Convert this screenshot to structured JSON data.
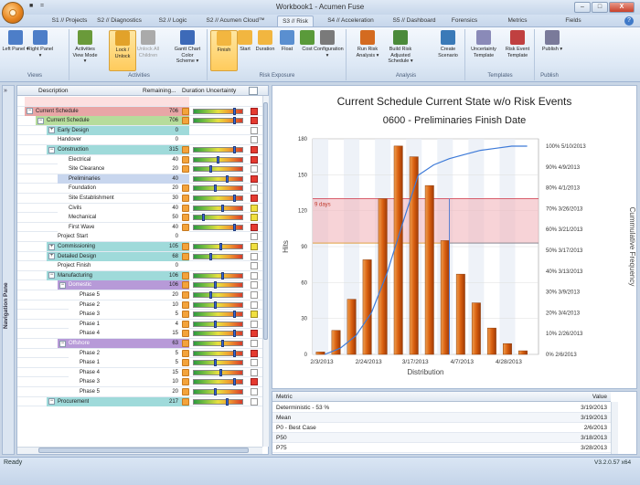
{
  "window": {
    "title": "Workbook1 - Acumen Fuse",
    "qat_save": "■",
    "qat_more": "=",
    "minimize": "–",
    "maximize": "□",
    "close": "X"
  },
  "tabs": [
    {
      "label": "S1 // Projects"
    },
    {
      "label": "S2 // Diagnostics"
    },
    {
      "label": "S2 // Logic"
    },
    {
      "label": "S2 // Acumen Cloud™"
    },
    {
      "label": "S3 // Risk"
    },
    {
      "label": "S4 // Acceleration"
    },
    {
      "label": "S5 // Dashboard"
    },
    {
      "label": "Forensics"
    },
    {
      "label": "Metrics"
    },
    {
      "label": "Fields"
    }
  ],
  "help_icon": "?",
  "ribbon": {
    "buttons": [
      {
        "label": "Left Panel ▾"
      },
      {
        "label": "Right Panel ▾"
      },
      {
        "label": "Activities View Mode ▾"
      },
      {
        "label": "Lock / Unlock"
      },
      {
        "label": "Unlock All Children"
      },
      {
        "label": "Gantt Chart Color Scheme ▾"
      },
      {
        "label": "Finish"
      },
      {
        "label": "Start"
      },
      {
        "label": "Duration"
      },
      {
        "label": "Float"
      },
      {
        "label": "Cost"
      },
      {
        "label": "Configuration ▾"
      },
      {
        "label": "Run Risk Analysis ▾"
      },
      {
        "label": "Build Risk Adjusted Schedule ▾"
      },
      {
        "label": "Create Scenario"
      },
      {
        "label": "Uncertainty Template"
      },
      {
        "label": "Risk Event Template"
      },
      {
        "label": "Publish ▾"
      }
    ],
    "groups": [
      {
        "label": "Views"
      },
      {
        "label": "Activities"
      },
      {
        "label": "Risk Exposure"
      },
      {
        "label": "Analysis"
      },
      {
        "label": "Templates"
      },
      {
        "label": "Publish"
      }
    ]
  },
  "nav_pane": {
    "label": "Navigation Pane",
    "collapse": "»"
  },
  "grid": {
    "headers": {
      "description": "Description",
      "remaining": "Remaining...",
      "uncertainty": "Duration Uncertainty"
    },
    "rows": [
      {
        "name": "",
        "val": "",
        "indent": 0,
        "tog": "",
        "bg": "#fce0e0"
      },
      {
        "name": "Current Schedule",
        "val": "706",
        "indent": 0,
        "tog": "−",
        "bg": "#e8a6a6",
        "ux": true,
        "bar": true,
        "thumb": 0.84,
        "gi": "r"
      },
      {
        "name": "Current Schedule",
        "val": "706",
        "indent": 1,
        "tog": "−",
        "bg": "#b6dc9b",
        "ux": true,
        "bar": true,
        "thumb": 0.84,
        "gi": "r"
      },
      {
        "name": "Early Design",
        "val": "0",
        "indent": 2,
        "tog": "+",
        "bg": "#9fdada",
        "gi": "w"
      },
      {
        "name": "Handover",
        "val": "0",
        "indent": 2,
        "tog": "",
        "bg": "#ffffff",
        "gi": "w"
      },
      {
        "name": "Construction",
        "val": "315",
        "indent": 2,
        "tog": "−",
        "bg": "#9fdada",
        "ux": true,
        "bar": true,
        "thumb": 0.84,
        "gi": "r"
      },
      {
        "name": "Electrical",
        "val": "40",
        "indent": 3,
        "tog": "",
        "bg": "#ffffff",
        "ux": true,
        "bar": true,
        "thumb": 0.5,
        "gi": "r"
      },
      {
        "name": "Site Clearance",
        "val": "20",
        "indent": 3,
        "tog": "",
        "bg": "#ffffff",
        "ux": true,
        "bar": true,
        "thumb": 0.35,
        "gi": "w"
      },
      {
        "name": "Preliminaries",
        "val": "40",
        "indent": 3,
        "tog": "",
        "bg": "#c8d6ee",
        "ux": false,
        "bar": true,
        "thumb": 0.7,
        "gi": "r"
      },
      {
        "name": "Foundation",
        "val": "20",
        "indent": 3,
        "tog": "",
        "bg": "#ffffff",
        "ux": true,
        "bar": true,
        "thumb": 0.45,
        "gi": "w"
      },
      {
        "name": "Site Establishment",
        "val": "30",
        "indent": 3,
        "tog": "",
        "bg": "#ffffff",
        "ux": true,
        "bar": true,
        "thumb": 0.84,
        "gi": "r"
      },
      {
        "name": "Civils",
        "val": "40",
        "indent": 3,
        "tog": "",
        "bg": "#ffffff",
        "ux": true,
        "bar": true,
        "thumb": 0.6,
        "gi": "y"
      },
      {
        "name": "Mechanical",
        "val": "50",
        "indent": 3,
        "tog": "",
        "bg": "#ffffff",
        "ux": true,
        "bar": true,
        "thumb": 0.2,
        "gi": "y"
      },
      {
        "name": "First Wave",
        "val": "40",
        "indent": 3,
        "tog": "",
        "bg": "#ffffff",
        "ux": true,
        "bar": true,
        "thumb": 0.84,
        "gi": "r"
      },
      {
        "name": "Project Start",
        "val": "0",
        "indent": 2,
        "tog": "",
        "bg": "#ffffff",
        "gi": "w"
      },
      {
        "name": "Commissioning",
        "val": "105",
        "indent": 2,
        "tog": "+",
        "bg": "#9fdada",
        "ux": true,
        "bar": true,
        "thumb": 0.55,
        "gi": "y"
      },
      {
        "name": "Detailed Design",
        "val": "68",
        "indent": 2,
        "tog": "+",
        "bg": "#9fdada",
        "ux": true,
        "bar": true,
        "thumb": 0.35,
        "gi": "w"
      },
      {
        "name": "Project Finish",
        "val": "0",
        "indent": 2,
        "tog": "",
        "bg": "#ffffff",
        "gi": "w"
      },
      {
        "name": "Manufacturing",
        "val": "106",
        "indent": 2,
        "tog": "−",
        "bg": "#9fdada",
        "ux": true,
        "bar": true,
        "thumb": 0.6,
        "gi": "w"
      },
      {
        "name": "Domestic",
        "val": "106",
        "indent": 3,
        "tog": "−",
        "bg": "#b79ad8",
        "ux": true,
        "bar": true,
        "thumb": 0.45,
        "gi": "w",
        "white": true
      },
      {
        "name": "Phase 5",
        "val": "20",
        "indent": 4,
        "tog": "",
        "bg": "#ffffff",
        "ux": true,
        "bar": true,
        "thumb": 0.35,
        "gi": "w"
      },
      {
        "name": "Phase 2",
        "val": "10",
        "indent": 4,
        "tog": "",
        "bg": "#ffffff",
        "ux": true,
        "bar": true,
        "thumb": 0.45,
        "gi": "w"
      },
      {
        "name": "Phase 3",
        "val": "5",
        "indent": 4,
        "tog": "",
        "bg": "#ffffff",
        "ux": true,
        "bar": true,
        "thumb": 0.84,
        "gi": "y"
      },
      {
        "name": "Phase 1",
        "val": "4",
        "indent": 4,
        "tog": "",
        "bg": "#ffffff",
        "ux": true,
        "bar": true,
        "thumb": 0.45,
        "gi": "w"
      },
      {
        "name": "Phase 4",
        "val": "15",
        "indent": 4,
        "tog": "",
        "bg": "#ffffff",
        "ux": true,
        "bar": true,
        "thumb": 0.84,
        "gi": "r"
      },
      {
        "name": "Offshore",
        "val": "63",
        "indent": 3,
        "tog": "−",
        "bg": "#b79ad8",
        "ux": true,
        "bar": true,
        "thumb": 0.6,
        "gi": "w",
        "white": true
      },
      {
        "name": "Phase 2",
        "val": "5",
        "indent": 4,
        "tog": "",
        "bg": "#ffffff",
        "ux": true,
        "bar": true,
        "thumb": 0.84,
        "gi": "r"
      },
      {
        "name": "Phase 1",
        "val": "5",
        "indent": 4,
        "tog": "",
        "bg": "#ffffff",
        "ux": true,
        "bar": true,
        "thumb": 0.45,
        "gi": "w"
      },
      {
        "name": "Phase 4",
        "val": "15",
        "indent": 4,
        "tog": "",
        "bg": "#ffffff",
        "ux": true,
        "bar": true,
        "thumb": 0.55,
        "gi": "w"
      },
      {
        "name": "Phase 3",
        "val": "10",
        "indent": 4,
        "tog": "",
        "bg": "#ffffff",
        "ux": true,
        "bar": true,
        "thumb": 0.84,
        "gi": "r"
      },
      {
        "name": "Phase 5",
        "val": "20",
        "indent": 4,
        "tog": "",
        "bg": "#ffffff",
        "ux": true,
        "bar": true,
        "thumb": 0.45,
        "gi": "w"
      },
      {
        "name": "Procurement",
        "val": "217",
        "indent": 2,
        "tog": "−",
        "bg": "#9fdada",
        "ux": true,
        "bar": true,
        "thumb": 0.7,
        "gi": "w"
      }
    ]
  },
  "chart_data": {
    "type": "bar",
    "title": "Current Schedule Current State w/o Risk Events",
    "subtitle": "0600 - Preliminaries Finish Date",
    "xlabel": "Distribution",
    "ylabel": "Hits",
    "y2label": "Cummulative Frequency",
    "ylim": [
      0,
      180
    ],
    "yticks": [
      0,
      30,
      60,
      90,
      120,
      150,
      180
    ],
    "xticks": [
      "2/3/2013",
      "2/24/2013",
      "3/17/2013",
      "4/7/2013",
      "4/28/2013"
    ],
    "y2ticks": [
      "0% 2/6/2013",
      "10% 2/26/2013",
      "20% 3/4/2013",
      "30% 3/9/2013",
      "40% 3/13/2013",
      "50% 3/17/2013",
      "60% 3/21/2013",
      "70% 3/26/2013",
      "80% 4/1/2013",
      "90% 4/9/2013",
      "100% 5/10/2013"
    ],
    "values": [
      2,
      20,
      46,
      79,
      130,
      174,
      165,
      141,
      95,
      67,
      43,
      22,
      9,
      3
    ],
    "cumulative": [
      0,
      3,
      9,
      20,
      39,
      63,
      86,
      91,
      94,
      96,
      98,
      99,
      100,
      100
    ],
    "band": {
      "label": "9 days",
      "low": 93,
      "high": 130
    },
    "mean_line": 100
  },
  "metrics": {
    "headers": {
      "metric": "Metric",
      "value": "Value"
    },
    "rows": [
      {
        "metric": "Deterministic - 53 %",
        "value": "3/19/2013"
      },
      {
        "metric": "Mean",
        "value": "3/19/2013"
      },
      {
        "metric": "P0 - Best Case",
        "value": "2/6/2013"
      },
      {
        "metric": "P50",
        "value": "3/18/2013"
      },
      {
        "metric": "P75",
        "value": "3/28/2013"
      }
    ]
  },
  "status": {
    "left": "Ready",
    "right": "V3.2.0.57 x64"
  }
}
